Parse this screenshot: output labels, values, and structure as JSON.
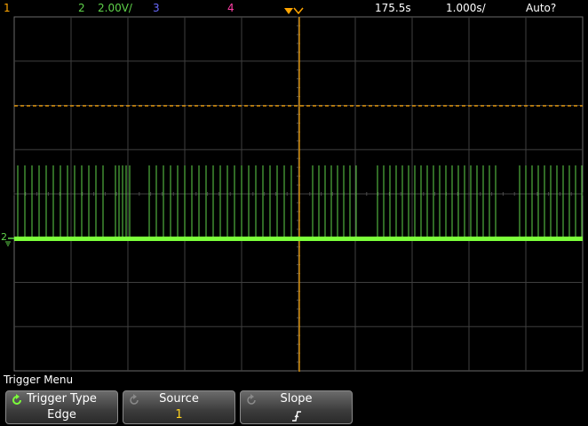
{
  "status_bar": {
    "ch1_label": "1",
    "ch2_label": "2",
    "ch2_scale": "2.00V/",
    "ch3_label": "3",
    "ch4_label": "4",
    "time_delay": "175.5s",
    "time_scale": "1.000s/",
    "trigger_mode": "Auto?"
  },
  "waveform": {
    "ch2_ground_marker": "2",
    "colors": {
      "ch1": "#ffa500",
      "ch2": "#5fd34a",
      "ch2_bright": "#7cff3a",
      "ch3": "#6a6aff",
      "ch4": "#ff3fa6",
      "grid": "#5a5a5a"
    }
  },
  "menu": {
    "title": "Trigger Menu",
    "softkeys": [
      {
        "label": "Trigger Type",
        "value": "Edge",
        "value_color": "#ffffff",
        "icon": "rotate-icon"
      },
      {
        "label": "Source",
        "value": "1",
        "value_color": "#ffd21f",
        "icon": "rotate-icon"
      },
      {
        "label": "Slope",
        "value": "rising-edge",
        "value_color": "#ffffff",
        "icon": "rotate-icon"
      }
    ]
  }
}
